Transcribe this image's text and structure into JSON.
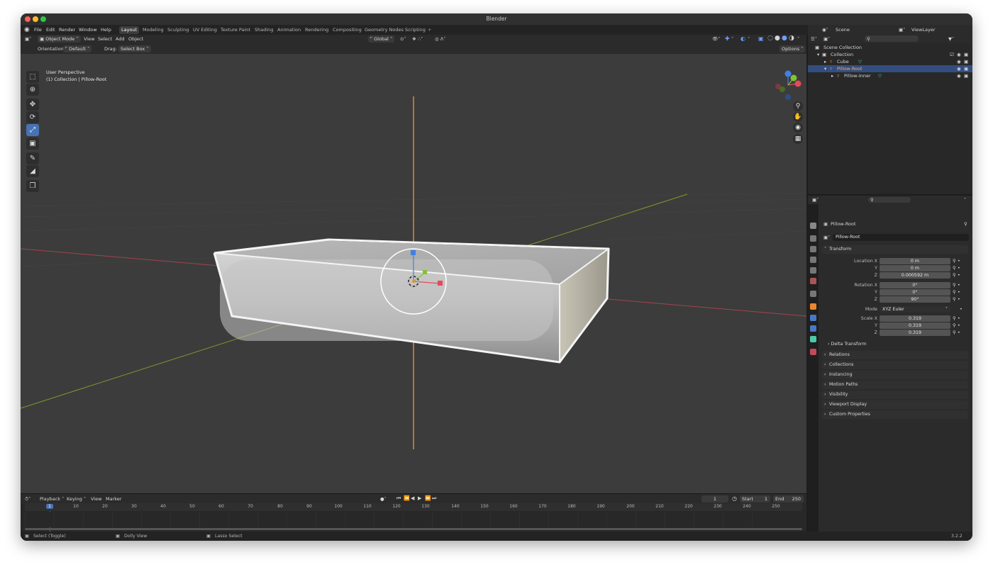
{
  "window": {
    "title": "Blender",
    "version": "3.2.2"
  },
  "menu": {
    "items": [
      "File",
      "Edit",
      "Render",
      "Window",
      "Help"
    ]
  },
  "workspaces": {
    "tabs": [
      "Layout",
      "Modeling",
      "Sculpting",
      "UV Editing",
      "Texture Paint",
      "Shading",
      "Animation",
      "Rendering",
      "Compositing",
      "Geometry Nodes",
      "Scripting"
    ],
    "active": "Layout",
    "add": "+"
  },
  "viewport_header": {
    "mode": "Object Mode",
    "menus": [
      "View",
      "Select",
      "Add",
      "Object"
    ],
    "transform_orientation": "Global"
  },
  "tool_header": {
    "orientation_label": "Orientation:",
    "orientation_value": "Default",
    "drag_label": "Drag:",
    "drag_value": "Select Box",
    "options": "Options"
  },
  "viewport": {
    "perspective": "User Perspective",
    "collection_info": "(1) Collection | Pillow-Root",
    "colors": {
      "bg": "#3c3c3c",
      "x_axis": "#a4424f",
      "y_axis": "#7d9a2e",
      "z_axis": "#e0923a",
      "selection": "#ffffff"
    }
  },
  "outliner": {
    "scene": "Scene",
    "view_layer": "ViewLayer",
    "items": [
      {
        "label": "Scene Collection",
        "depth": 0
      },
      {
        "label": "Collection",
        "depth": 1
      },
      {
        "label": "Cube",
        "depth": 2
      },
      {
        "label": "Pillow-Root",
        "depth": 2,
        "selected": true
      },
      {
        "label": "Pillow-Inner",
        "depth": 3
      }
    ]
  },
  "properties": {
    "object_name": "Pillow-Root",
    "data_name": "Pillow-Root",
    "transform": {
      "title": "Transform",
      "location": {
        "label": "Location X",
        "x": "0 m",
        "y": "0 m",
        "z": "0.000592 m"
      },
      "rotation": {
        "label": "Rotation X",
        "x": "0°",
        "y": "0°",
        "z": "90°"
      },
      "mode": {
        "label": "Mode",
        "value": "XYZ Euler"
      },
      "scale": {
        "label": "Scale X",
        "x": "0.319",
        "y": "0.319",
        "z": "0.319"
      },
      "axis_y": "Y",
      "axis_z": "Z",
      "delta": "Delta Transform"
    },
    "panels": [
      "Relations",
      "Collections",
      "Instancing",
      "Motion Paths",
      "Visibility",
      "Viewport Display",
      "Custom Properties"
    ]
  },
  "timeline": {
    "menus": [
      "Playback",
      "Keying",
      "View",
      "Marker"
    ],
    "current_frame": "1",
    "start_label": "Start",
    "start": "1",
    "end_label": "End",
    "end": "250",
    "ticks": [
      "1",
      "10",
      "20",
      "30",
      "40",
      "50",
      "60",
      "70",
      "80",
      "90",
      "100",
      "110",
      "120",
      "130",
      "140",
      "150",
      "160",
      "170",
      "180",
      "190",
      "200",
      "210",
      "220",
      "230",
      "240",
      "250"
    ]
  },
  "status_bar": {
    "select": "Select (Toggle)",
    "dolly": "Dolly View",
    "lasso": "Lasso Select"
  }
}
